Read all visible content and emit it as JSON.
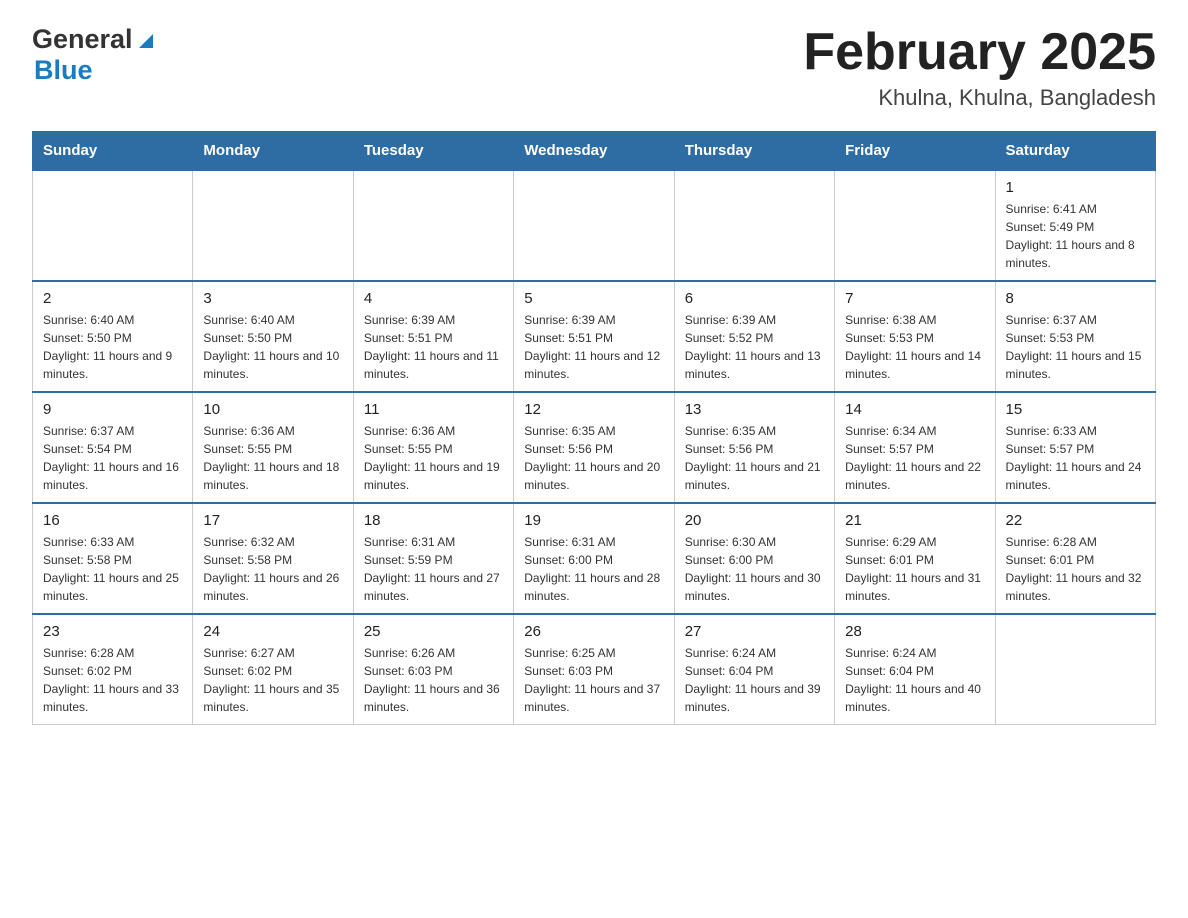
{
  "header": {
    "logo_general": "General",
    "logo_blue": "Blue",
    "title": "February 2025",
    "subtitle": "Khulna, Khulna, Bangladesh"
  },
  "weekdays": [
    "Sunday",
    "Monday",
    "Tuesday",
    "Wednesday",
    "Thursday",
    "Friday",
    "Saturday"
  ],
  "weeks": [
    [
      {
        "day": "",
        "info": ""
      },
      {
        "day": "",
        "info": ""
      },
      {
        "day": "",
        "info": ""
      },
      {
        "day": "",
        "info": ""
      },
      {
        "day": "",
        "info": ""
      },
      {
        "day": "",
        "info": ""
      },
      {
        "day": "1",
        "info": "Sunrise: 6:41 AM\nSunset: 5:49 PM\nDaylight: 11 hours and 8 minutes."
      }
    ],
    [
      {
        "day": "2",
        "info": "Sunrise: 6:40 AM\nSunset: 5:50 PM\nDaylight: 11 hours and 9 minutes."
      },
      {
        "day": "3",
        "info": "Sunrise: 6:40 AM\nSunset: 5:50 PM\nDaylight: 11 hours and 10 minutes."
      },
      {
        "day": "4",
        "info": "Sunrise: 6:39 AM\nSunset: 5:51 PM\nDaylight: 11 hours and 11 minutes."
      },
      {
        "day": "5",
        "info": "Sunrise: 6:39 AM\nSunset: 5:51 PM\nDaylight: 11 hours and 12 minutes."
      },
      {
        "day": "6",
        "info": "Sunrise: 6:39 AM\nSunset: 5:52 PM\nDaylight: 11 hours and 13 minutes."
      },
      {
        "day": "7",
        "info": "Sunrise: 6:38 AM\nSunset: 5:53 PM\nDaylight: 11 hours and 14 minutes."
      },
      {
        "day": "8",
        "info": "Sunrise: 6:37 AM\nSunset: 5:53 PM\nDaylight: 11 hours and 15 minutes."
      }
    ],
    [
      {
        "day": "9",
        "info": "Sunrise: 6:37 AM\nSunset: 5:54 PM\nDaylight: 11 hours and 16 minutes."
      },
      {
        "day": "10",
        "info": "Sunrise: 6:36 AM\nSunset: 5:55 PM\nDaylight: 11 hours and 18 minutes."
      },
      {
        "day": "11",
        "info": "Sunrise: 6:36 AM\nSunset: 5:55 PM\nDaylight: 11 hours and 19 minutes."
      },
      {
        "day": "12",
        "info": "Sunrise: 6:35 AM\nSunset: 5:56 PM\nDaylight: 11 hours and 20 minutes."
      },
      {
        "day": "13",
        "info": "Sunrise: 6:35 AM\nSunset: 5:56 PM\nDaylight: 11 hours and 21 minutes."
      },
      {
        "day": "14",
        "info": "Sunrise: 6:34 AM\nSunset: 5:57 PM\nDaylight: 11 hours and 22 minutes."
      },
      {
        "day": "15",
        "info": "Sunrise: 6:33 AM\nSunset: 5:57 PM\nDaylight: 11 hours and 24 minutes."
      }
    ],
    [
      {
        "day": "16",
        "info": "Sunrise: 6:33 AM\nSunset: 5:58 PM\nDaylight: 11 hours and 25 minutes."
      },
      {
        "day": "17",
        "info": "Sunrise: 6:32 AM\nSunset: 5:58 PM\nDaylight: 11 hours and 26 minutes."
      },
      {
        "day": "18",
        "info": "Sunrise: 6:31 AM\nSunset: 5:59 PM\nDaylight: 11 hours and 27 minutes."
      },
      {
        "day": "19",
        "info": "Sunrise: 6:31 AM\nSunset: 6:00 PM\nDaylight: 11 hours and 28 minutes."
      },
      {
        "day": "20",
        "info": "Sunrise: 6:30 AM\nSunset: 6:00 PM\nDaylight: 11 hours and 30 minutes."
      },
      {
        "day": "21",
        "info": "Sunrise: 6:29 AM\nSunset: 6:01 PM\nDaylight: 11 hours and 31 minutes."
      },
      {
        "day": "22",
        "info": "Sunrise: 6:28 AM\nSunset: 6:01 PM\nDaylight: 11 hours and 32 minutes."
      }
    ],
    [
      {
        "day": "23",
        "info": "Sunrise: 6:28 AM\nSunset: 6:02 PM\nDaylight: 11 hours and 33 minutes."
      },
      {
        "day": "24",
        "info": "Sunrise: 6:27 AM\nSunset: 6:02 PM\nDaylight: 11 hours and 35 minutes."
      },
      {
        "day": "25",
        "info": "Sunrise: 6:26 AM\nSunset: 6:03 PM\nDaylight: 11 hours and 36 minutes."
      },
      {
        "day": "26",
        "info": "Sunrise: 6:25 AM\nSunset: 6:03 PM\nDaylight: 11 hours and 37 minutes."
      },
      {
        "day": "27",
        "info": "Sunrise: 6:24 AM\nSunset: 6:04 PM\nDaylight: 11 hours and 39 minutes."
      },
      {
        "day": "28",
        "info": "Sunrise: 6:24 AM\nSunset: 6:04 PM\nDaylight: 11 hours and 40 minutes."
      },
      {
        "day": "",
        "info": ""
      }
    ]
  ]
}
